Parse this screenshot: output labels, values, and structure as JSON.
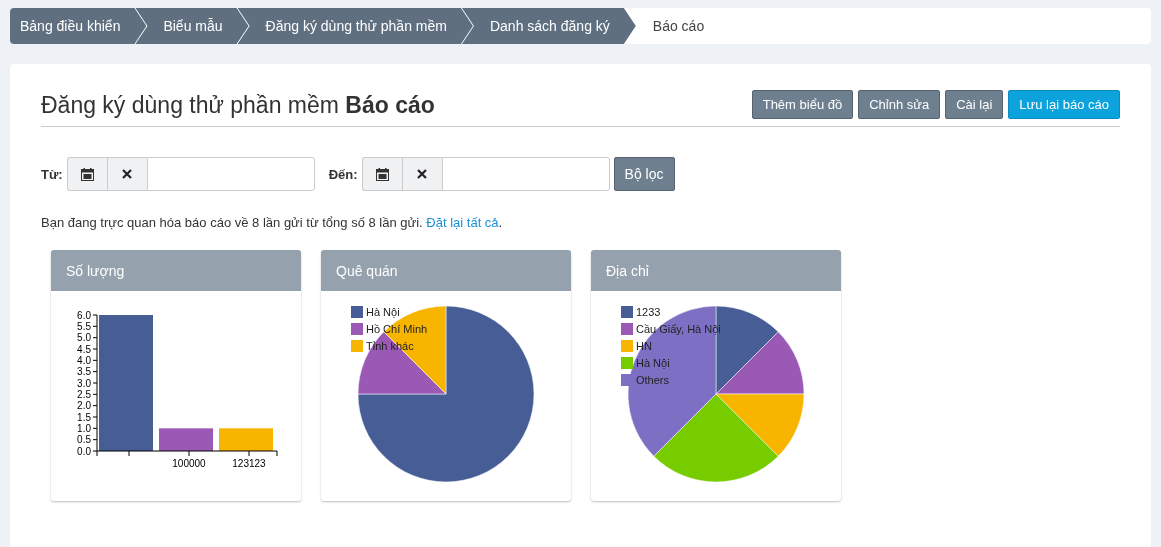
{
  "breadcrumbs": [
    {
      "label": "Bảng điều khiển",
      "selected": false
    },
    {
      "label": "Biểu mẫu",
      "selected": false
    },
    {
      "label": "Đăng ký dùng thử phần mềm",
      "selected": false
    },
    {
      "label": "Danh sách đăng ký",
      "selected": false
    },
    {
      "label": "Báo cáo",
      "selected": true
    }
  ],
  "title": "Đăng ký dùng thử phần mềm **Báo cáo**",
  "buttons": [
    {
      "label": "Thêm biểu đồ",
      "kind": "secondary"
    },
    {
      "label": "Chỉnh sửa",
      "kind": "secondary"
    },
    {
      "label": "Cài lại",
      "kind": "secondary"
    },
    {
      "label": "Lưu lại báo cáo",
      "kind": "primary"
    }
  ],
  "filters": [
    {
      "label": "Từ:"
    },
    {
      "label": "Đến:"
    }
  ],
  "filter_button": "Bộ lọc",
  "info": {
    "text": "Bạn đang trực quan hóa báo cáo về 8 lần gửi từ tổng số 8 lần gửi. ",
    "link": "Đặt lại tất cả",
    "suffix": "."
  },
  "charts": [
    {
      "title": "Số lượng",
      "chart_data": {
        "type": "bar",
        "categories": [
          null,
          "100000",
          "123123"
        ],
        "colors": [
          "#475d96",
          "#9b59b6",
          "#f7b500"
        ],
        "values": [
          6,
          1,
          1
        ],
        "ylim": [
          0,
          6
        ],
        "yticks": [
          {
            "value": 0,
            "label": "0.0"
          },
          {
            "value": 0.5,
            "label": "0.5"
          },
          {
            "value": 1,
            "label": "1.0"
          },
          {
            "value": 1.5,
            "label": "1.5"
          },
          {
            "value": 2,
            "label": "2.0"
          },
          {
            "value": 2.5,
            "label": "2.5"
          },
          {
            "value": 3,
            "label": "3.0"
          },
          {
            "value": 3.5,
            "label": "3.5"
          },
          {
            "value": 4,
            "label": "4.0"
          },
          {
            "value": 4.5,
            "label": "4.5"
          },
          {
            "value": 5,
            "label": "5.0"
          },
          {
            "value": 5.5,
            "label": "5.5"
          },
          {
            "value": 6,
            "label": "6.0"
          }
        ]
      }
    },
    {
      "title": "Quê quán",
      "chart_data": {
        "type": "pie",
        "categories": [
          "Hà Nội",
          "Hồ Chí Minh",
          "Tỉnh khác"
        ],
        "values": [
          75,
          12.5,
          12.5
        ],
        "colors": [
          "#475d96",
          "#9b59b6",
          "#f7b500"
        ],
        "legend": true
      }
    },
    {
      "title": "Địa chỉ",
      "chart_data": {
        "type": "pie",
        "categories": [
          "1233",
          "Cầu Giấy, Hà Nội",
          "HN",
          "Hà Nội",
          "Others"
        ],
        "values": [
          12.5,
          12.5,
          12.5,
          25,
          37.5
        ],
        "colors": [
          "#475d96",
          "#9b59b6",
          "#f7b500",
          "#77cc00",
          "#7d6fc4"
        ],
        "legend": true
      }
    }
  ]
}
